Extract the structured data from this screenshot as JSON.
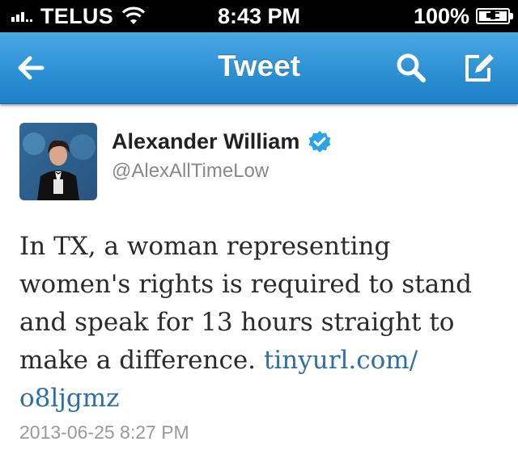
{
  "status_bar": {
    "carrier": "TELUS",
    "time": "8:43 PM",
    "battery": "100%"
  },
  "nav": {
    "title": "Tweet",
    "back_icon": "back-arrow-icon",
    "search_icon": "search-icon",
    "compose_icon": "compose-icon"
  },
  "tweet": {
    "author_name": "Alexander William",
    "verified": true,
    "handle": "@AlexAllTimeLow",
    "text_lines": [
      "In TX, a woman representing",
      "women's rights is required to stand",
      "and speak for 13 hours straight to",
      "make a difference. "
    ],
    "link_part1": "tinyurl.com/",
    "link_part2": "o8ljgmz",
    "timestamp": "2013-06-25 8:27 PM"
  },
  "colors": {
    "nav_bar": "#2f93d6",
    "link": "#2c6fa8",
    "verified_badge": "#2aa3e8"
  }
}
